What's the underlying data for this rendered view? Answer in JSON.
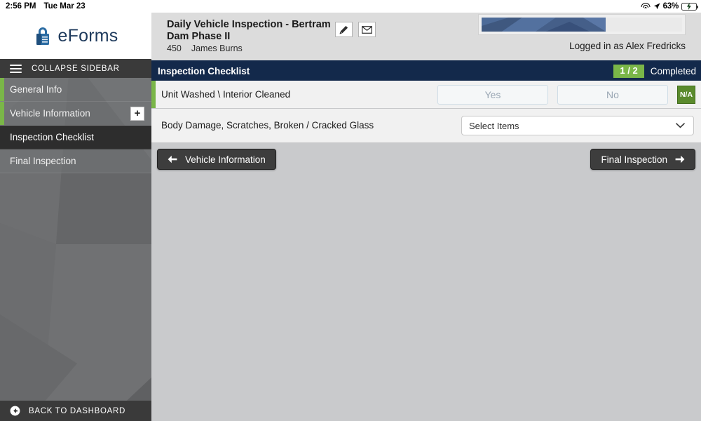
{
  "statusbar": {
    "time": "2:56 PM",
    "date": "Tue Mar 23",
    "wifi_icon": "wifi-icon",
    "location_icon": "location-arrow-icon",
    "battery_percent": "63%",
    "battery_icon": "battery-charging-icon",
    "battery_level": 63
  },
  "sidebar": {
    "logo_text": "eForms",
    "logo_icon": "padlock-icon",
    "collapse_label": "COLLAPSE SIDEBAR",
    "menu_icon": "hamburger-menu-icon",
    "items": [
      {
        "label": "General Info",
        "state": "done"
      },
      {
        "label": "Vehicle Information",
        "state": "done",
        "expand_label": "+"
      },
      {
        "label": "Inspection Checklist",
        "state": "active"
      },
      {
        "label": "Final Inspection",
        "state": "default"
      }
    ],
    "back_label": "BACK TO DASHBOARD",
    "back_icon": "circle-back-arrow-icon"
  },
  "header": {
    "title": "Daily Vehicle Inspection - Bertram Dam Phase II",
    "sub_number": "450",
    "sub_name": "James  Burns",
    "edit_icon": "pencil-icon",
    "mail_icon": "envelope-icon",
    "progress_percent": 62,
    "logged_in": "Logged in as Alex Fredricks"
  },
  "section": {
    "title": "Inspection Checklist",
    "badge": "1 / 2",
    "completed_label": "Completed"
  },
  "rows": [
    {
      "label": "Unit Washed \\ Interior Cleaned",
      "yes_label": "Yes",
      "no_label": "No",
      "na_label": "N/A",
      "state": "done"
    },
    {
      "label": "Body Damage, Scratches, Broken / Cracked Glass",
      "select_value": "Select Items",
      "chevron_icon": "chevron-down-icon",
      "state": "default"
    }
  ],
  "nav_buttons": {
    "prev_label": "Vehicle Information",
    "prev_icon": "arrow-left-icon",
    "next_label": "Final Inspection",
    "next_icon": "arrow-right-icon"
  },
  "colors": {
    "navy": "#13294b",
    "green": "#7ab648",
    "sidebar_dark": "#3a3a3a",
    "button_dark": "#3d3d3d",
    "content_bg": "#c9cacc"
  }
}
